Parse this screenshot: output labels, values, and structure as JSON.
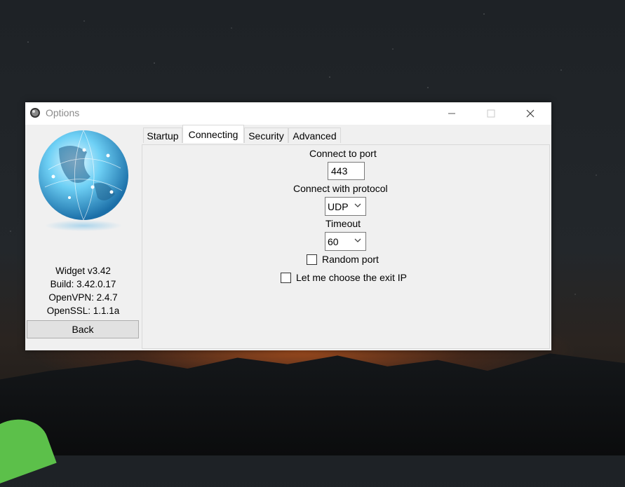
{
  "window": {
    "title": "Options",
    "controls": {
      "minimize": "—",
      "maximize": "☐",
      "close": "✕"
    }
  },
  "sidebar": {
    "info_lines": [
      "Widget v3.42",
      "Build: 3.42.0.17",
      "OpenVPN: 2.4.7",
      "OpenSSL: 1.1.1a"
    ],
    "back_label": "Back"
  },
  "tabs": [
    {
      "label": "Startup",
      "active": false
    },
    {
      "label": "Connecting",
      "active": true
    },
    {
      "label": "Security",
      "active": false
    },
    {
      "label": "Advanced",
      "active": false
    }
  ],
  "connecting": {
    "port_label": "Connect to port",
    "port_value": "443",
    "protocol_label": "Connect with protocol",
    "protocol_value": "UDP",
    "timeout_label": "Timeout",
    "timeout_value": "60",
    "random_port_label": "Random port",
    "random_port_checked": false,
    "exit_ip_label": "Let me choose the exit IP",
    "exit_ip_checked": false
  },
  "icons": {
    "app": "globe-app-icon",
    "dropdown": "chevron-down-icon"
  },
  "colors": {
    "window_bg": "#f0f0f0",
    "titlebar_bg": "#ffffff",
    "title_text": "#8a8a8a",
    "globe_accent": "#3aa7e6"
  }
}
